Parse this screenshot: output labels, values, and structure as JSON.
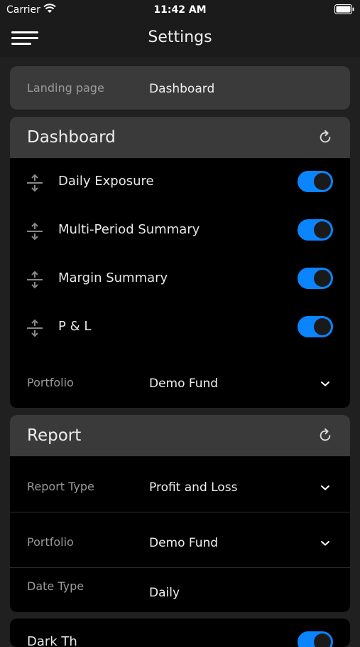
{
  "status": {
    "carrier": "Carrier",
    "time": "11:42 AM"
  },
  "nav": {
    "title": "Settings",
    "menu_icon": "hamburger-menu-icon"
  },
  "landing": {
    "label": "Landing page",
    "value": "Dashboard"
  },
  "dashboard": {
    "title": "Dashboard",
    "items": [
      {
        "label": "Daily Exposure",
        "enabled": true
      },
      {
        "label": "Multi-Period Summary",
        "enabled": true
      },
      {
        "label": "Margin Summary",
        "enabled": true
      },
      {
        "label": "P & L",
        "enabled": true
      }
    ],
    "portfolio_label": "Portfolio",
    "portfolio_value": "Demo Fund"
  },
  "report": {
    "title": "Report",
    "type_label": "Report Type",
    "type_value": "Profit and Loss",
    "portfolio_label": "Portfolio",
    "portfolio_value": "Demo Fund",
    "date_type_label": "Date Type",
    "date_type_value": "Daily"
  },
  "bottom": {
    "label": "Dark Th",
    "enabled": true
  },
  "colors": {
    "accent": "#0a84ff",
    "background": "#202020",
    "card": "#000000",
    "header": "#3a3a3a"
  }
}
